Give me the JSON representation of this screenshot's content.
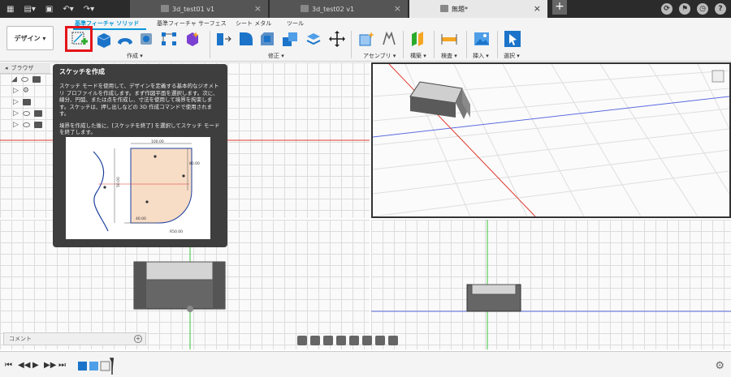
{
  "titlebar": {
    "tabs": [
      {
        "label": "3d_test01 v1",
        "active": false
      },
      {
        "label": "3d_test02 v1",
        "active": false
      },
      {
        "label": "無題*",
        "active": true
      }
    ],
    "new_tab": "+",
    "help": "?"
  },
  "toolbar": {
    "design_label": "デザイン ▾",
    "workspace_tabs": [
      "基準フィーチャ ソリッド",
      "基準フィーチャ サーフェス",
      "シート メタル",
      "ツール"
    ],
    "groups": [
      "作成 ▾",
      "修正 ▾",
      "アセンブリ ▾",
      "構築 ▾",
      "検査 ▾",
      "挿入 ▾",
      "選択 ▾"
    ]
  },
  "browser": {
    "title": "ブラウザ"
  },
  "tooltip": {
    "title": "スケッチを作成",
    "body1": "スケッチ モードを使用して、デザインを定義する基本的なジオメトリ プロファイルを作成します。まず作図平面を選択します。次に、線分、円弧、または点を作成し、寸法を使用して境界を拘束します。スケッチは、押し出しなどの 3D 作成コマンドで使用されます。",
    "body2": "境界を作成した後に、[スケッチを終了] を選択してスケッチ モードを終了します。",
    "dims": [
      "100.00",
      "80.00",
      "50.00",
      "40.00",
      "R50.00"
    ]
  },
  "comment": {
    "label": "コメント"
  },
  "colors": {
    "accent": "#0696d7",
    "highlight": "#e3151a",
    "tooltip_bg": "#3e3e3e",
    "titlebar": "#2b2b2b"
  }
}
